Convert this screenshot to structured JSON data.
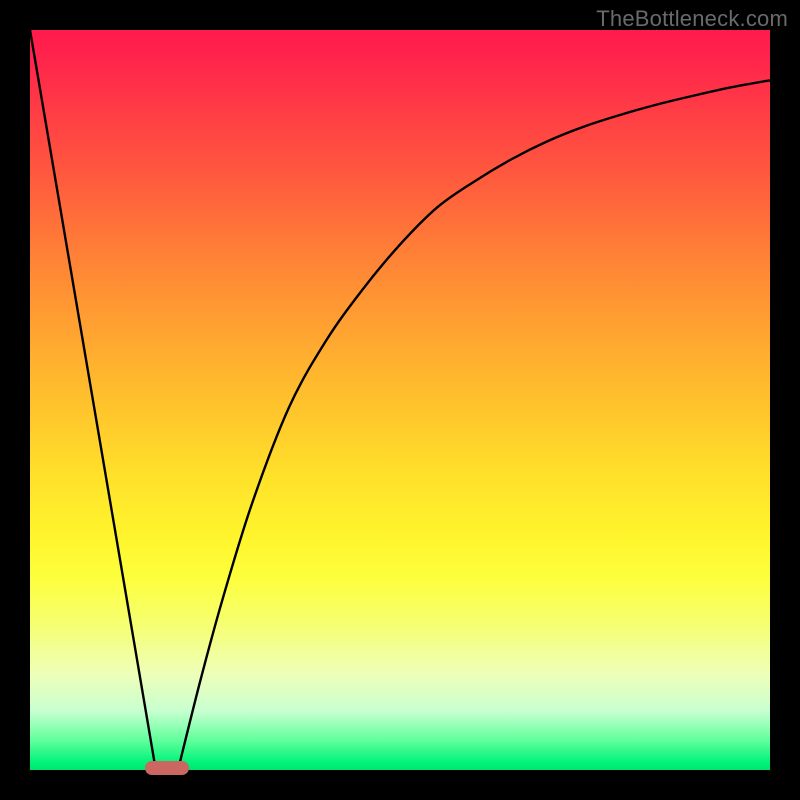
{
  "watermark": "TheBottleneck.com",
  "colors": {
    "frame": "#000000",
    "curve": "#000000",
    "marker": "#cb6661"
  },
  "chart_data": {
    "type": "line",
    "title": "",
    "xlabel": "",
    "ylabel": "",
    "xlim": [
      0,
      100
    ],
    "ylim": [
      0,
      100
    ],
    "legend": false,
    "series": [
      {
        "name": "left-segment",
        "x": [
          0,
          17
        ],
        "values": [
          100,
          0
        ]
      },
      {
        "name": "right-curve",
        "x": [
          20,
          23,
          26,
          30,
          35,
          40,
          45,
          50,
          55,
          60,
          65,
          70,
          75,
          80,
          85,
          90,
          95,
          100
        ],
        "values": [
          0,
          12,
          23,
          36,
          49,
          58,
          65,
          71,
          76,
          79.5,
          82.5,
          85,
          87,
          88.6,
          90,
          91.2,
          92.3,
          93.2
        ]
      }
    ],
    "marker": {
      "x_range": [
        15.5,
        21.5
      ],
      "y": 0,
      "color": "#cb6661"
    },
    "background_gradient": {
      "direction": "vertical",
      "stops": [
        {
          "pos": 0,
          "color": "#ff1a4d"
        },
        {
          "pos": 50,
          "color": "#ffc72c"
        },
        {
          "pos": 80,
          "color": "#f6ff6e"
        },
        {
          "pos": 100,
          "color": "#00e46f"
        }
      ]
    }
  }
}
